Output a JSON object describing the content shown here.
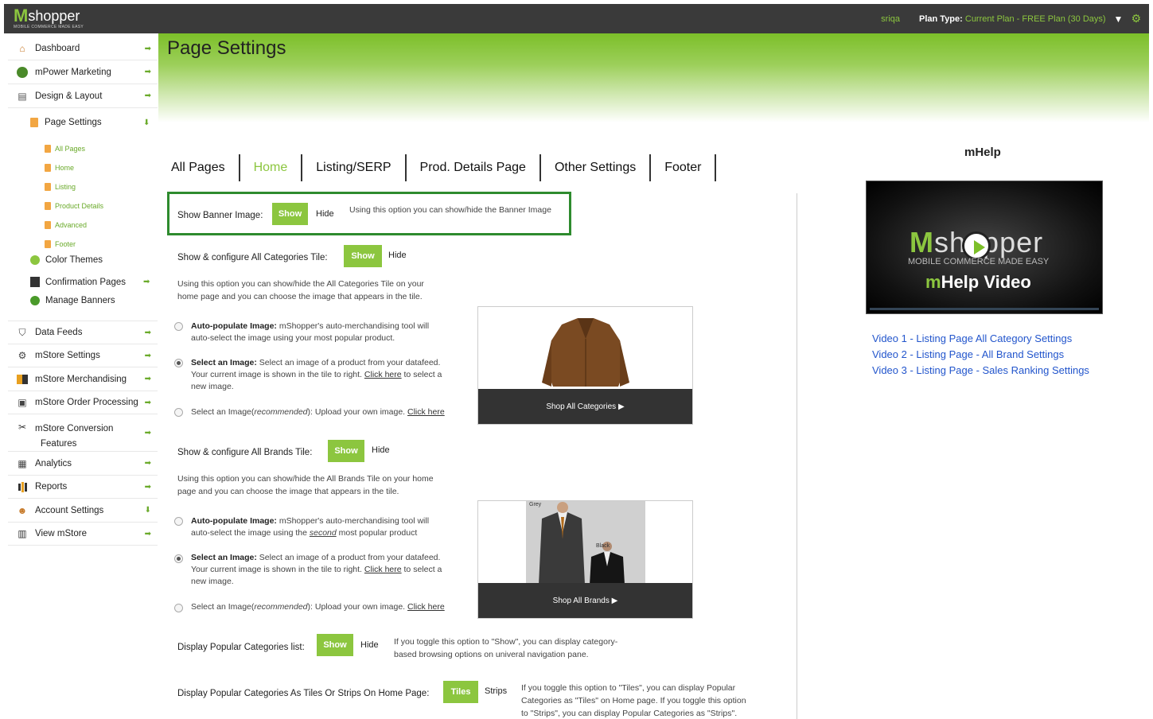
{
  "topbar": {
    "logo_m": "M",
    "logo_text": "shopper",
    "logo_tagline": "MOBILE COMMERCE MADE EASY",
    "username": "sriqa",
    "plan_label": "Plan Type:",
    "plan_value": "Current Plan - FREE Plan (30 Days)",
    "dropdown_icon": "triangle-down-icon",
    "settings_icon": "gear-icon"
  },
  "page": {
    "title": "Page Settings"
  },
  "sidebar": {
    "items": [
      {
        "label": "Dashboard",
        "icon": "home-icon"
      },
      {
        "label": "mPower Marketing",
        "icon": "rocket-icon"
      },
      {
        "label": "Design & Layout",
        "icon": "layout-icon"
      },
      {
        "label": "Page Settings",
        "icon": "page-icon"
      },
      {
        "label": "All Pages"
      },
      {
        "label": "Home"
      },
      {
        "label": "Listing"
      },
      {
        "label": "Product Details"
      },
      {
        "label": "Advanced"
      },
      {
        "label": "Footer"
      },
      {
        "label": "Color Themes",
        "icon": "palette-icon"
      },
      {
        "label": "Confirmation Pages",
        "icon": "document-icon"
      },
      {
        "label": "Manage Banners",
        "icon": "banner-icon"
      },
      {
        "label": "Data Feeds",
        "icon": "feed-icon"
      },
      {
        "label": "mStore Settings",
        "icon": "settings-icon"
      },
      {
        "label": "mStore Merchandising",
        "icon": "merch-icon"
      },
      {
        "label": "mStore Order Processing",
        "icon": "order-icon"
      },
      {
        "label": "mStore Conversion",
        "label2": "Features",
        "icon": "conversion-icon"
      },
      {
        "label": "Analytics",
        "icon": "analytics-icon"
      },
      {
        "label": "Reports",
        "icon": "reports-icon"
      },
      {
        "label": "Account Settings",
        "icon": "user-icon"
      },
      {
        "label": "View mStore",
        "icon": "store-icon"
      }
    ]
  },
  "tabs": [
    "All Pages",
    "Home",
    "Listing/SERP",
    "Prod. Details Page",
    "Other Settings",
    "Footer"
  ],
  "active_tab": "Home",
  "settings": {
    "banner": {
      "label": "Show Banner Image:",
      "show": "Show",
      "hide": "Hide",
      "desc": "Using this option you can show/hide the Banner Image"
    },
    "categories": {
      "label": "Show & configure All Categories Tile:",
      "show": "Show",
      "hide": "Hide",
      "desc1": "Using this option you can show/hide the All Categories Tile on your",
      "desc2": "home page and you can choose the image that appears in the tile.",
      "opt1_bold": "Auto-populate Image:",
      "opt1_l1": "mShopper's auto-merchandising tool will",
      "opt1_l2": "auto-select the image using your most popular product.",
      "opt2_bold": "Select an Image:",
      "opt2_l1": "Select an image of a product from your datafeed.",
      "opt2_l2a": "Your current image is shown in the tile to right.",
      "opt2_link": "Click here",
      "opt2_l2b": "to select a",
      "opt2_l3": "new image.",
      "opt3_bold": "Select an Image(",
      "opt3_ital": "recommended",
      "opt3_close": "):",
      "opt3_text": "Upload your own image.",
      "opt3_link": "Click here",
      "tile_label": "Shop All Categories"
    },
    "brands": {
      "label": "Show & configure All Brands Tile:",
      "show": "Show",
      "hide": "Hide",
      "desc1": "Using this option you can show/hide the All Brands Tile on your home",
      "desc2": "page and you can choose the image that appears in the tile.",
      "opt1_bold": "Auto-populate Image:",
      "opt1_l1": "mShopper's auto-merchandising tool will",
      "opt1_l2a": "auto-select the image using the",
      "opt1_ital": "second",
      "opt1_l2b": "most popular product",
      "opt2_bold": "Select an Image:",
      "opt2_l1": "Select an image of a product from your datafeed.",
      "opt2_l2a": "Your current image is shown in the tile to right.",
      "opt2_link": "Click here",
      "opt2_l2b": "to select a",
      "opt2_l3": "new image.",
      "opt3_bold": "Select an Image(",
      "opt3_ital": "recommended",
      "opt3_close": "):",
      "opt3_text": "Upload your own image.",
      "opt3_link": "Click here",
      "tile_label": "Shop All Brands",
      "tile_grey": "Grey",
      "tile_black": "Black"
    },
    "popular_list": {
      "label": "Display Popular Categories list:",
      "show": "Show",
      "hide": "Hide",
      "desc1": "If you toggle this option to \"Show\", you can display category-",
      "desc2": "based browsing options on univeral navigation pane."
    },
    "popular_tiles": {
      "label": "Display Popular Categories As Tiles Or Strips On Home Page:",
      "tiles": "Tiles",
      "strips": "Strips",
      "desc1": "If you toggle this option to \"Tiles\", you can display Popular",
      "desc2": "Categories as \"Tiles\" on Home page. If you toggle this option",
      "desc3": "to \"Strips\", you can display Popular Categories as \"Strips\"."
    }
  },
  "mhelp": {
    "title": "mHelp",
    "video_logo_m": "M",
    "video_logo_text": "shopper",
    "video_tagline": "MOBILE COMMERCE MADE EASY",
    "video_title_m": "m",
    "video_title": "Help Video",
    "links": [
      "Video 1 -  Listing Page All Category Settings",
      "Video 2 -  Listing Page - All Brand Settings",
      "Video 3 -  Listing Page - Sales Ranking Settings"
    ]
  },
  "colors": {
    "accent": "#8cc63f",
    "topbar": "#3a3a3a",
    "highlight_border": "#2e8b2e",
    "link": "#2255cc"
  }
}
